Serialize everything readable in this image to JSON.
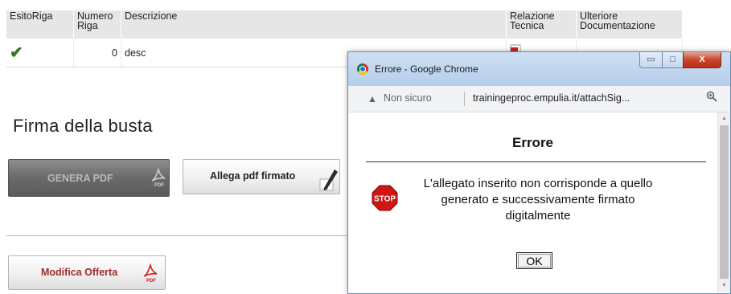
{
  "table": {
    "headers": {
      "esito": "EsitoRiga",
      "numero_line1": "Numero",
      "numero_line2": "Riga",
      "descrizione": "Descrizione",
      "relazione_line1": "Relazione",
      "relazione_line2": "Tecnica",
      "ulteriore_line1": "Ulteriore",
      "ulteriore_line2": "Documentazione"
    },
    "rows": [
      {
        "esito_icon": "green-checkmark-icon",
        "numero": "0",
        "descrizione": "desc",
        "relazione_icon": "pdf-file-icon"
      }
    ]
  },
  "section": {
    "title": "Firma della busta"
  },
  "buttons": {
    "genera_pdf": {
      "label": "GENERA PDF",
      "icon": "pdf-icon",
      "state": "disabled"
    },
    "allega_pdf": {
      "label": "Allega pdf firmato",
      "icon": "pen-icon"
    },
    "modifica_offerta": {
      "label": "Modifica Offerta",
      "icon": "pdf-icon"
    }
  },
  "popup": {
    "window_title": "Errore - Google Chrome",
    "security_label": "Non sicuro",
    "url": "trainingeproc.empulia.it/attachSig...",
    "window_buttons": {
      "minimize": "▭",
      "maximize": "□",
      "close": "X"
    },
    "error_title": "Errore",
    "error_message": "L'allegato inserito non corrisponde a quello generato e successivamente firmato digitalmente",
    "stop_sign_text": "STOP",
    "ok_label": "OK"
  },
  "colors": {
    "check": "#2f7d1e",
    "modifica_text": "#a12a2a",
    "stop_red": "#d01515",
    "titlebar": "#c4d7f0",
    "close_button": "#c8452b"
  }
}
